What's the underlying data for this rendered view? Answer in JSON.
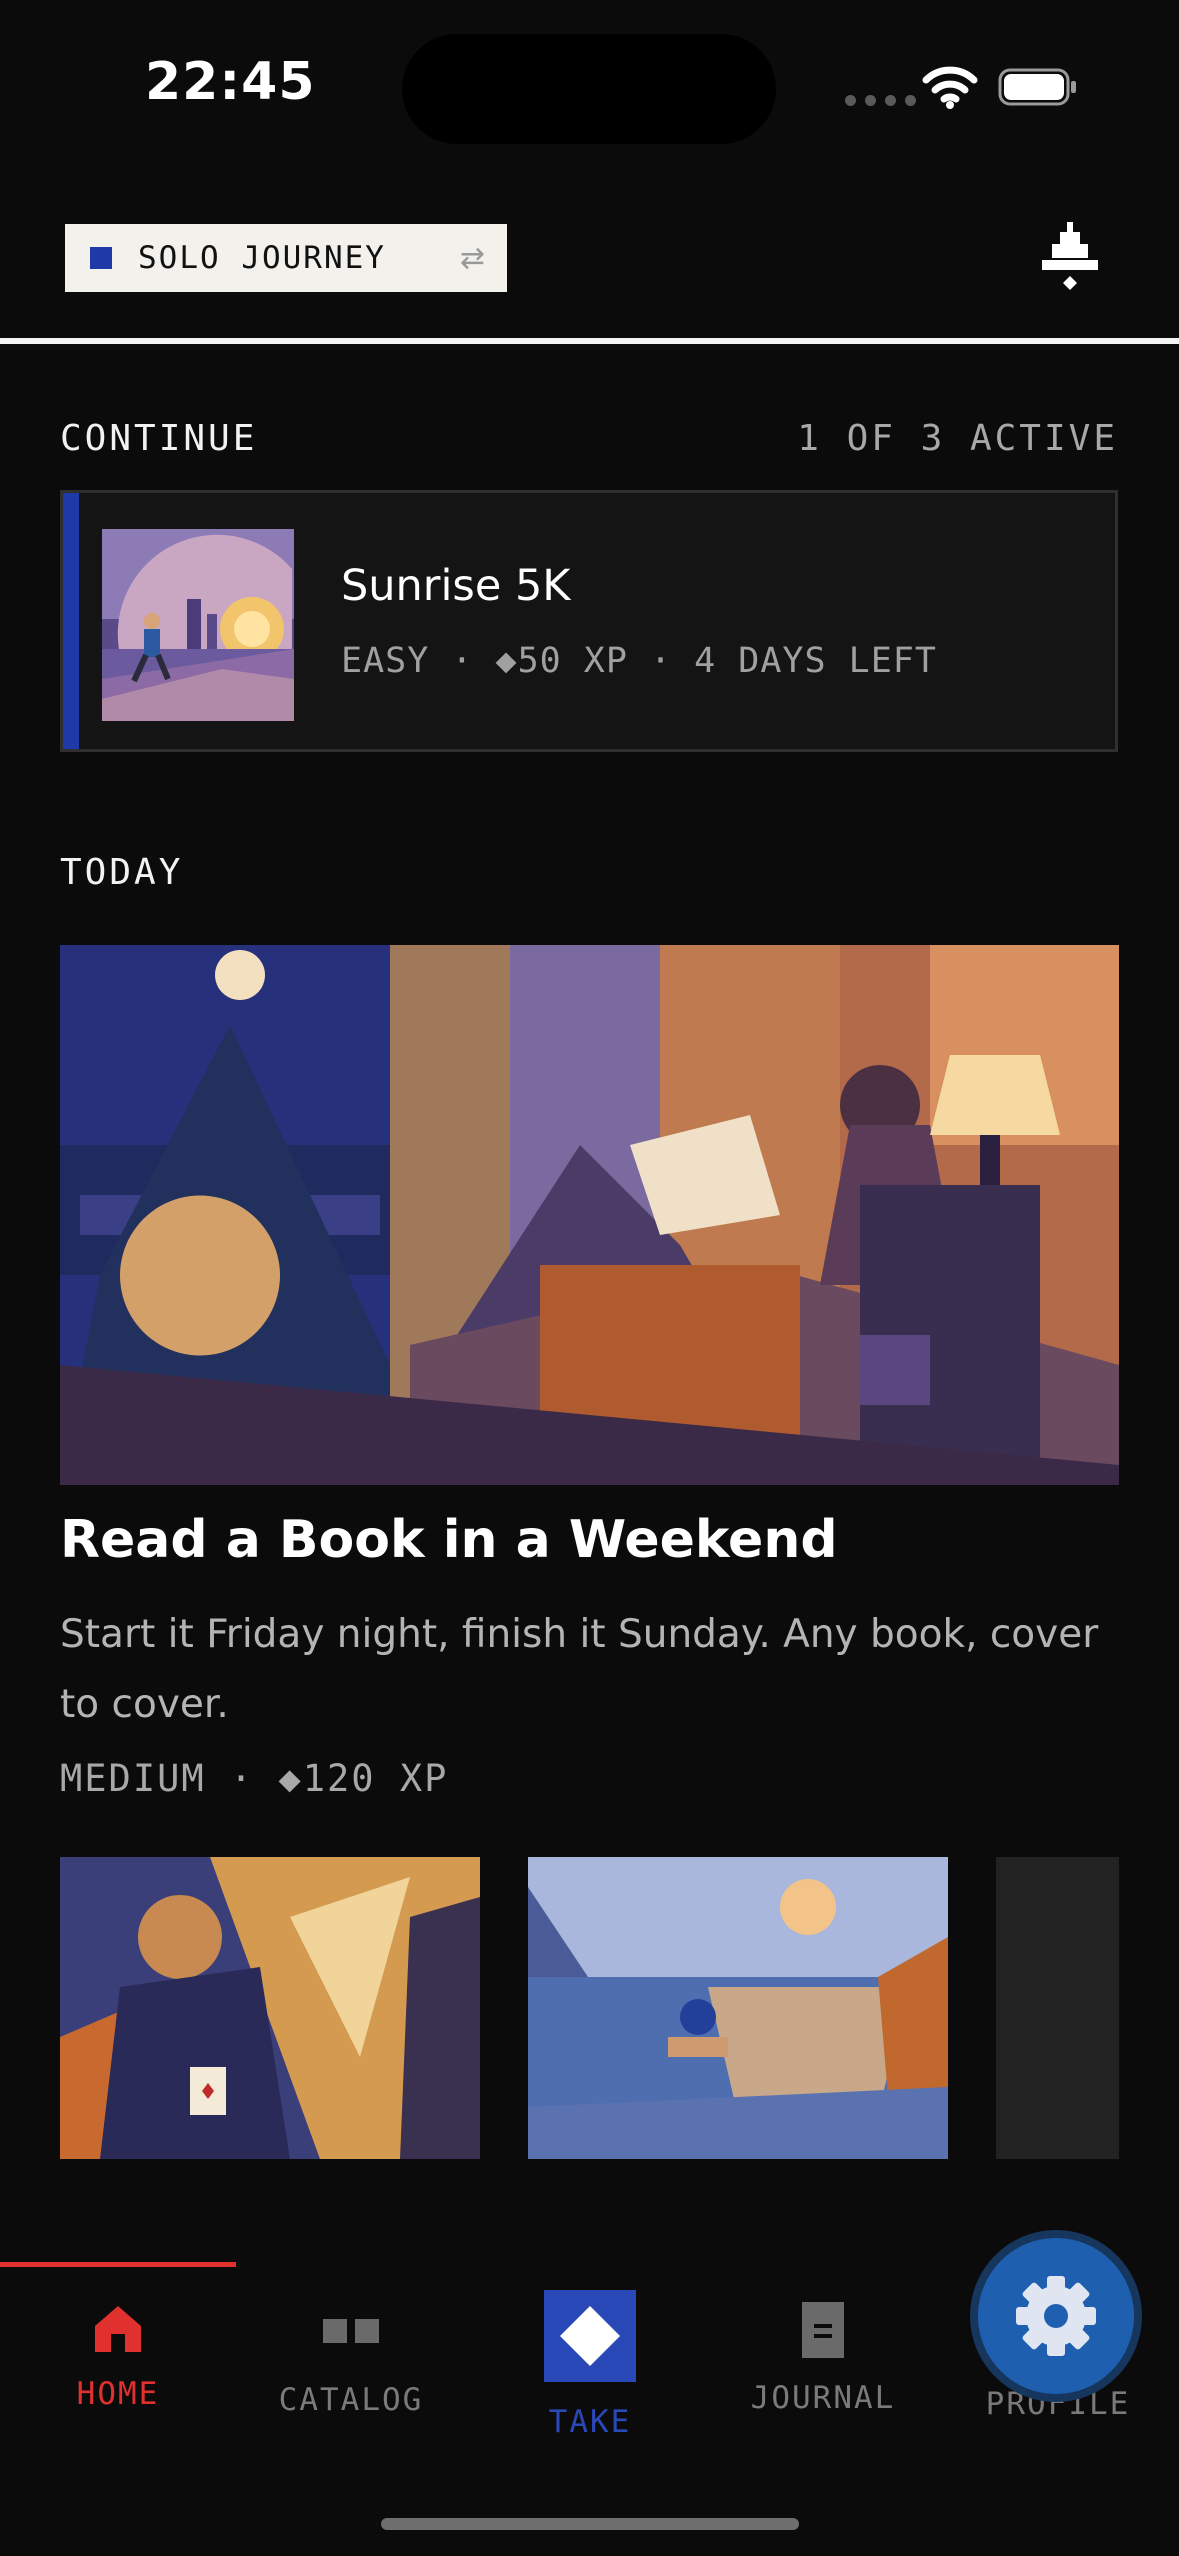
{
  "status_bar": {
    "time": "22:45"
  },
  "header": {
    "mode_label": "SOLO JOURNEY",
    "mode_swap_glyph": "⇄",
    "bell_icon": "bell-icon"
  },
  "continue": {
    "title": "CONTINUE",
    "count": "1 OF 3 ACTIVE",
    "card": {
      "title": "Sunrise 5K",
      "meta": "EASY · ◆50 XP · 4 DAYS LEFT"
    }
  },
  "today": {
    "title": "TODAY",
    "hero": {
      "title": "Read a Book in a Weekend",
      "description": "Start it Friday night, finish it Sunday. Any book, cover to cover.",
      "meta": "MEDIUM · ◆120 XP"
    }
  },
  "nav": {
    "items": [
      {
        "label": "HOME",
        "icon": "home-icon"
      },
      {
        "label": "CATALOG",
        "icon": "catalog-icon"
      },
      {
        "label": "TAKE",
        "icon": "diamond-icon"
      },
      {
        "label": "JOURNAL",
        "icon": "journal-icon"
      },
      {
        "label": "PROFILE",
        "icon": "gear-icon"
      }
    ]
  },
  "colors": {
    "accent_blue": "#1f3aa8",
    "active_red": "#e0312e",
    "take_blue": "#2a49b8",
    "fab_blue": "#1f5fb0"
  }
}
